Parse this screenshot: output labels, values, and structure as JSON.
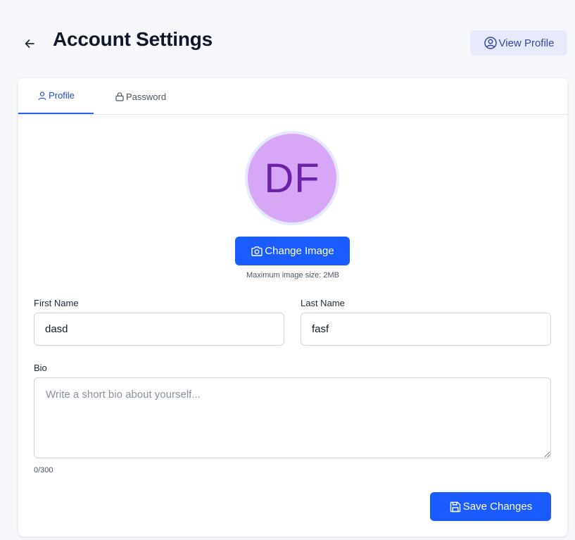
{
  "header": {
    "title": "Account Settings",
    "back_icon": "arrow-left-icon",
    "view_profile_label": "View Profile",
    "view_profile_icon": "user-circle-icon"
  },
  "tabs": [
    {
      "label": "Profile",
      "icon": "user-icon",
      "active": true
    },
    {
      "label": "Password",
      "icon": "lock-icon",
      "active": false
    }
  ],
  "profile": {
    "avatar_initials": "DF",
    "avatar_color": "#d8a6f6",
    "change_image_label": "Change Image",
    "change_image_icon": "camera-icon",
    "image_note": "Maximum image size: 2MB",
    "first_name": {
      "label": "First Name",
      "value": "dasd"
    },
    "last_name": {
      "label": "Last Name",
      "value": "fasf"
    },
    "bio": {
      "label": "Bio",
      "value": "",
      "placeholder": "Write a short bio about yourself...",
      "counter": "0/300"
    },
    "save_label": "Save Changes",
    "save_icon": "save-icon"
  },
  "colors": {
    "primary": "#1a5cff",
    "accent_tab": "#2563eb",
    "view_profile_bg": "#e6eafb"
  }
}
